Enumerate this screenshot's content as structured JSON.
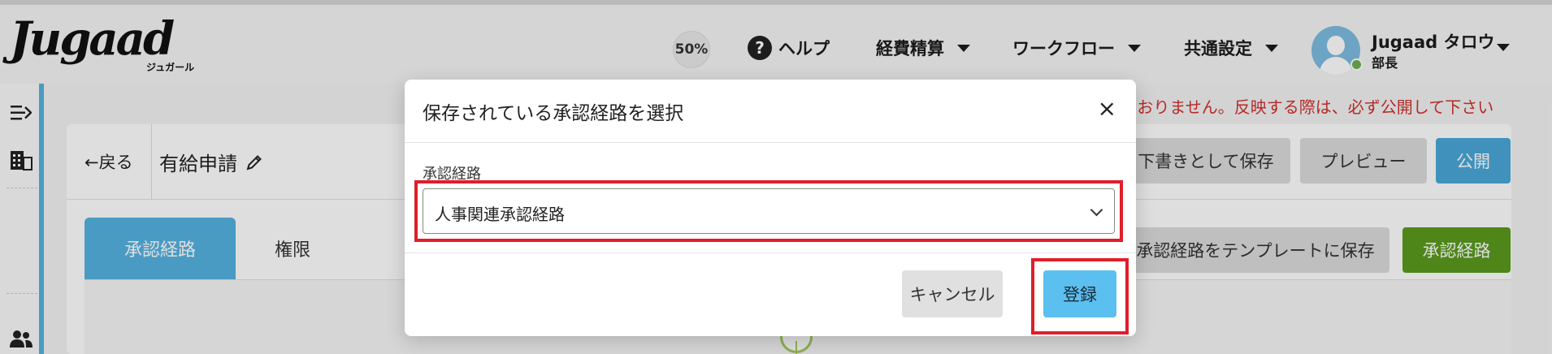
{
  "header": {
    "logo": "Jugaad",
    "logo_sub": "ジュガール",
    "zoom": "50%",
    "nav": [
      {
        "label": "ヘルプ",
        "icon": "help-circle-icon"
      },
      {
        "label": "経費精算"
      },
      {
        "label": "ワークフロー"
      },
      {
        "label": "共通設定"
      }
    ],
    "user": {
      "name": "Jugaad タロウ",
      "role": "部長",
      "status_color": "#6ab04c"
    }
  },
  "sidebar": {
    "icons": [
      "collapse-menu-icon",
      "building-icon",
      "users-icon"
    ]
  },
  "main": {
    "warning": "ておりません。反映する際は、必ず公開して下さい",
    "back": "←戻る",
    "title": "有給申請",
    "buttons": {
      "save_draft": "下書きとして保存",
      "preview": "プレビュー",
      "publish": "公開",
      "save_template": "承認経路をテンプレートに保存",
      "route": "承認経路"
    },
    "tabs": [
      "承認経路",
      "権限"
    ]
  },
  "modal": {
    "title": "保存されている承認経路を選択",
    "close": "×",
    "field_label": "承認経路",
    "selected": "人事関連承認経路",
    "cancel": "キャンセル",
    "submit": "登録"
  },
  "colors": {
    "accent": "#55b3e0",
    "primary_button": "#4aa8d8",
    "submit_button": "#5bc0f0",
    "green_button": "#5a9a1e",
    "warning_text": "#d0312d",
    "highlight": "#e01e2a"
  }
}
